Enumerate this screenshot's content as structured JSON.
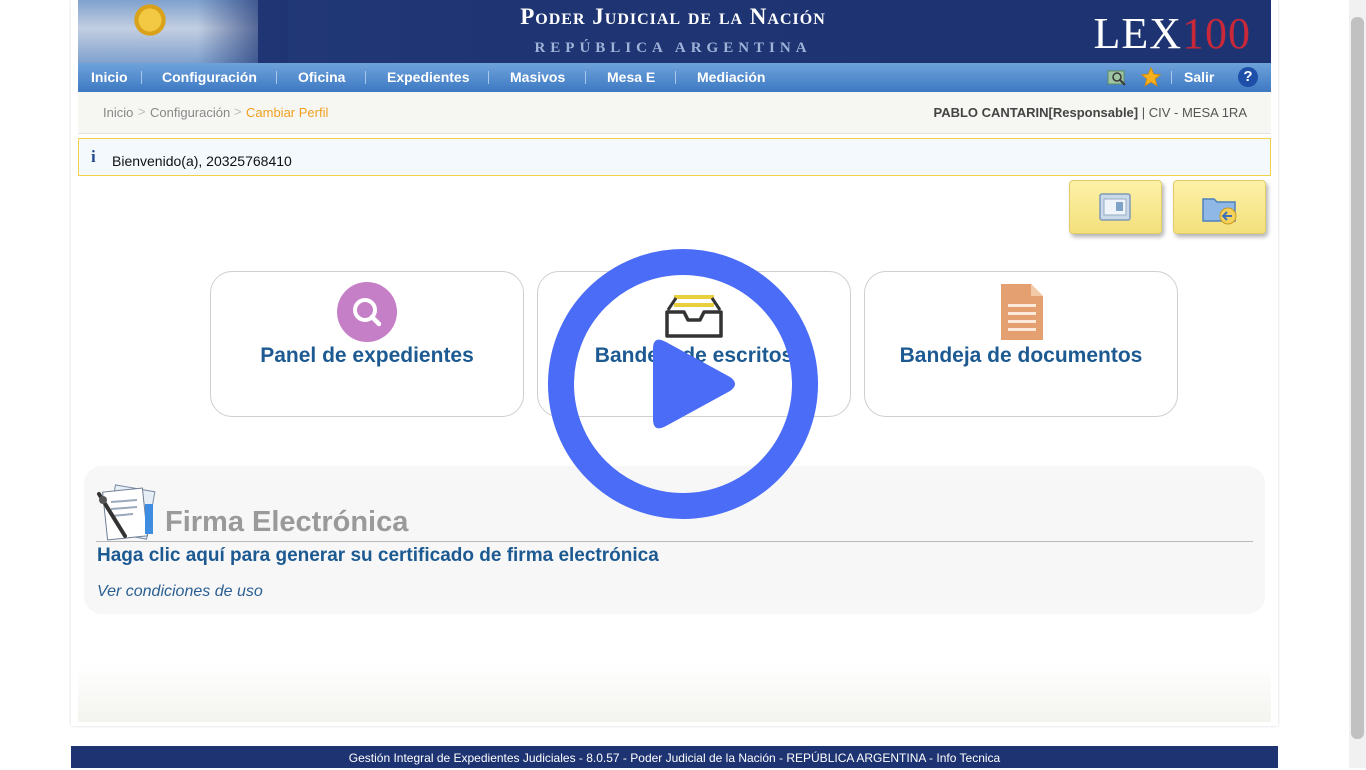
{
  "header": {
    "title_main": "Poder Judicial de la Nación",
    "title_sub": "REPÚBLICA ARGENTINA",
    "logo_lex": "LEX",
    "logo_num": "100"
  },
  "nav": {
    "items": [
      "Inicio",
      "Configuración",
      "Oficina",
      "Expedientes",
      "Masivos",
      "Mesa E",
      "Mediación"
    ],
    "salir": "Salir",
    "help": "?"
  },
  "breadcrumb": [
    "Inicio",
    "Configuración",
    "Cambiar Perfil"
  ],
  "user": {
    "name": "PABLO CANTARIN[Responsable]",
    "office": "| CIV - MESA 1RA"
  },
  "info": {
    "icon": "i",
    "message": "Bienvenido(a), 20325768410"
  },
  "cards": [
    {
      "label": "Panel de expedientes",
      "icon": "search-icon"
    },
    {
      "label": "Bandeja de escritos",
      "icon": "inbox-icon"
    },
    {
      "label": "Bandeja de documentos",
      "icon": "document-icon"
    }
  ],
  "firma": {
    "title": "Firma Electrónica",
    "link": "Haga clic aquí para generar su certificado de firma electrónica",
    "conditions": "Ver condiciones de uso"
  },
  "footer": "Gestión Integral de Expedientes Judiciales - 8.0.57 - Poder Judicial de la Nación - REPÚBLICA ARGENTINA - Info Tecnica",
  "colors": {
    "header_bg": "#1f3573",
    "nav_bg": "#4a86cc",
    "link_blue": "#1d5a92",
    "breadcrumb_active": "#f0a020",
    "play_overlay": "#4a6cf7"
  }
}
